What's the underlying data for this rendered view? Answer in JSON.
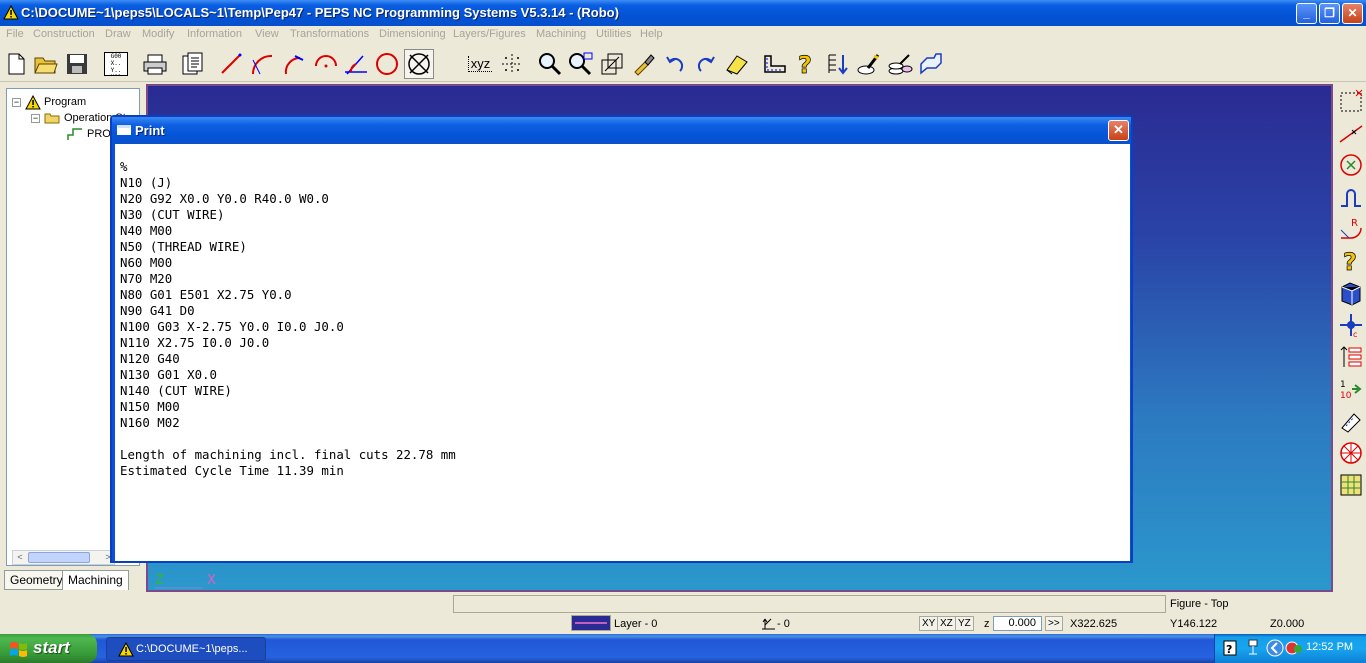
{
  "window": {
    "title": "C:\\DOCUME~1\\peps5\\LOCALS~1\\Temp\\Pep47 - PEPS NC Programming Systems V5.3.14 - (Robo)"
  },
  "menu": [
    "File",
    "Construction",
    "Draw",
    "Modify",
    "Information",
    "View",
    "Transformations",
    "Dimensioning",
    "Layers/Figures",
    "Machining",
    "Utilities",
    "Help"
  ],
  "toolbar_text": {
    "gcode_button": "G00 X.. Y.. M01",
    "xyz_button": "xyz"
  },
  "tree": {
    "root": "Program",
    "child": "Operation St",
    "grandchild": "PRO"
  },
  "left_tabs": {
    "geometry": "Geometry",
    "machining": "Machining"
  },
  "canvas_axes": {
    "z": "Z",
    "x": "X"
  },
  "dialog": {
    "title": "Print",
    "close": "✕",
    "lines": [
      "%",
      "N10 (J)",
      "N20 G92 X0.0 Y0.0 R40.0 W0.0",
      "N30 (CUT WIRE)",
      "N40 M00",
      "N50 (THREAD WIRE)",
      "N60 M00",
      "N70 M20",
      "N80 G01 E501 X2.75 Y0.0",
      "N90 G41 D0",
      "N100 G03 X-2.75 Y0.0 I0.0 J0.0",
      "N110 X2.75 I0.0 J0.0",
      "N120 G40",
      "N130 G01 X0.0",
      "N140 (CUT WIRE)",
      "N150 M00",
      "N160 M02",
      "",
      "Length of machining incl. final cuts 22.78 mm",
      "Estimated Cycle Time 11.39 min"
    ]
  },
  "status": {
    "figure": "Figure - Top",
    "layer": "Layer - 0",
    "angle": "- 0",
    "views": [
      "XY",
      "XZ",
      "YZ"
    ],
    "z_label": "z",
    "z_value": "0.000",
    "more": ">>",
    "x_coord": "X322.625",
    "y_coord": "Y146.122",
    "z_coord": "Z0.000"
  },
  "taskbar": {
    "start": "start",
    "item": "C:\\DOCUME~1\\peps...",
    "clock": "12:52 PM"
  },
  "colors": {
    "titlebar": "#0353d6",
    "canvas_top": "#2a2b92",
    "canvas_bottom": "#2b98cc",
    "start_green": "#3c9e3c"
  }
}
